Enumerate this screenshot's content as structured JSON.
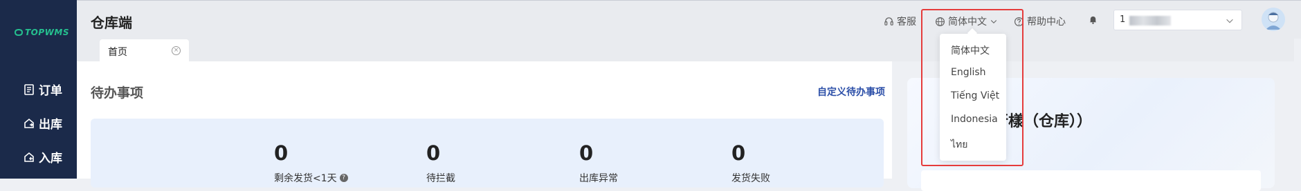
{
  "sidebar": {
    "logo": "TOPWMS",
    "items": [
      {
        "label": "订单",
        "icon": "order-icon"
      },
      {
        "label": "出库",
        "icon": "outbound-icon"
      },
      {
        "label": "入库",
        "icon": "inbound-icon"
      }
    ]
  },
  "header": {
    "title": "仓库端",
    "service_label": "客服",
    "language_label": "简体中文",
    "help_label": "帮助中心",
    "user_value": "1",
    "colors": {
      "accent": "#2c4fa8",
      "highlight": "#e53b3b",
      "sidebar": "#1b2a4a",
      "logo": "#25c08f"
    }
  },
  "tabs": [
    {
      "label": "首页"
    }
  ],
  "todo": {
    "title": "待办事项",
    "custom_link": "自定义待办事项",
    "stats": [
      {
        "value": "0",
        "label": "剩余发货<1天"
      },
      {
        "value": "0",
        "label": "待拦截"
      },
      {
        "value": "0",
        "label": "出库异常"
      },
      {
        "value": "0",
        "label": "发货失败"
      }
    ]
  },
  "right_panel": {
    "title_visible": "行樣（仓库））"
  },
  "language_dropdown": {
    "options": [
      "简体中文",
      "English",
      "Tiếng Việt",
      "Indonesia",
      "ไทย"
    ]
  }
}
